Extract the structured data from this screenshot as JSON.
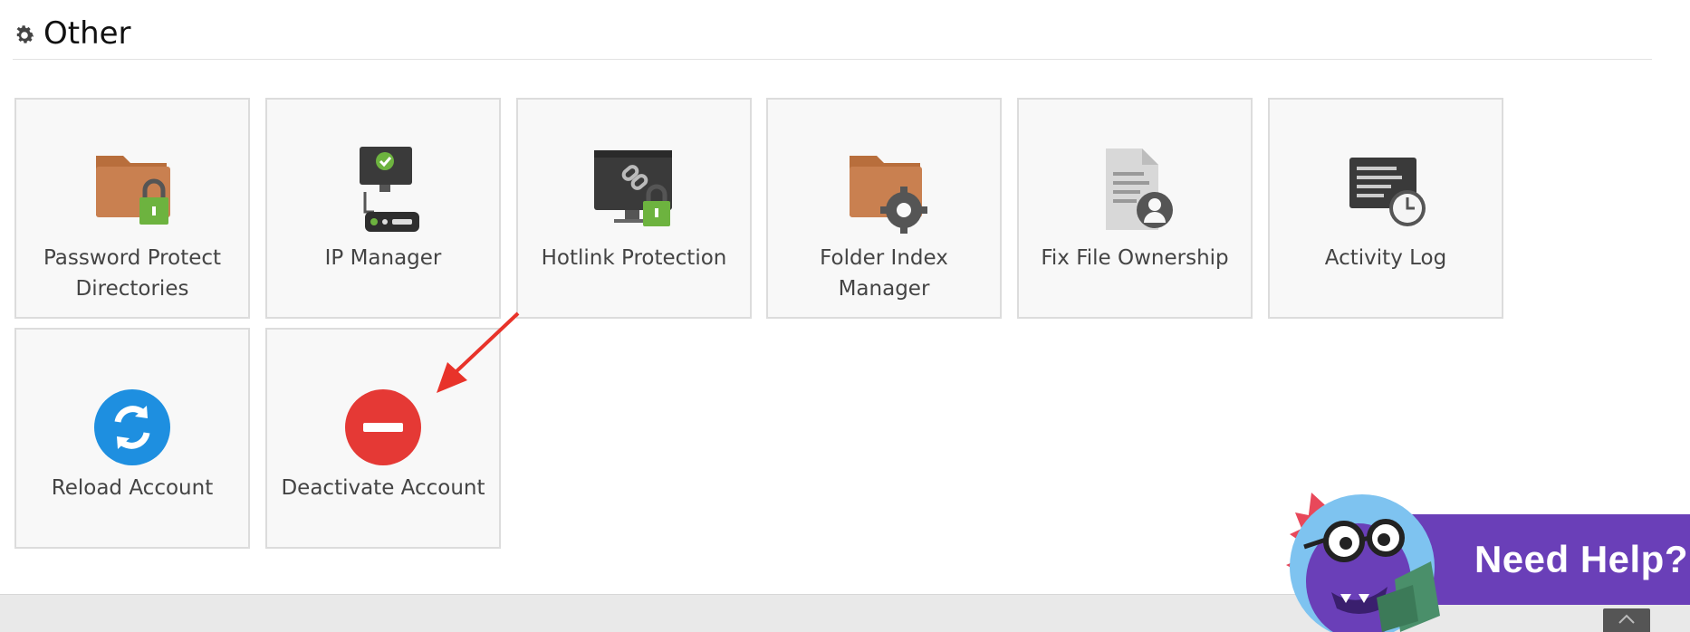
{
  "section": {
    "title": "Other",
    "icon": "gear-icon"
  },
  "tiles": [
    {
      "label": "Password Protect Directories",
      "icon": "locked-folder-icon"
    },
    {
      "label": "IP Manager",
      "icon": "ip-manager-icon"
    },
    {
      "label": "Hotlink Protection",
      "icon": "hotlink-protection-icon"
    },
    {
      "label": "Folder Index Manager",
      "icon": "folder-gear-icon"
    },
    {
      "label": "Fix File Ownership",
      "icon": "file-ownership-icon"
    },
    {
      "label": "Activity Log",
      "icon": "activity-log-icon"
    },
    {
      "label": "Reload Account",
      "icon": "reload-icon"
    },
    {
      "label": "Deactivate Account",
      "icon": "deactivate-icon"
    }
  ],
  "help": {
    "label": "Need Help?"
  },
  "colors": {
    "folder": "#c47a4a",
    "lock": "#6db33f",
    "reload": "#1e8fe0",
    "deactivate": "#e53935",
    "help_bg": "#6a3fb8",
    "arrow": "#e8332a"
  }
}
